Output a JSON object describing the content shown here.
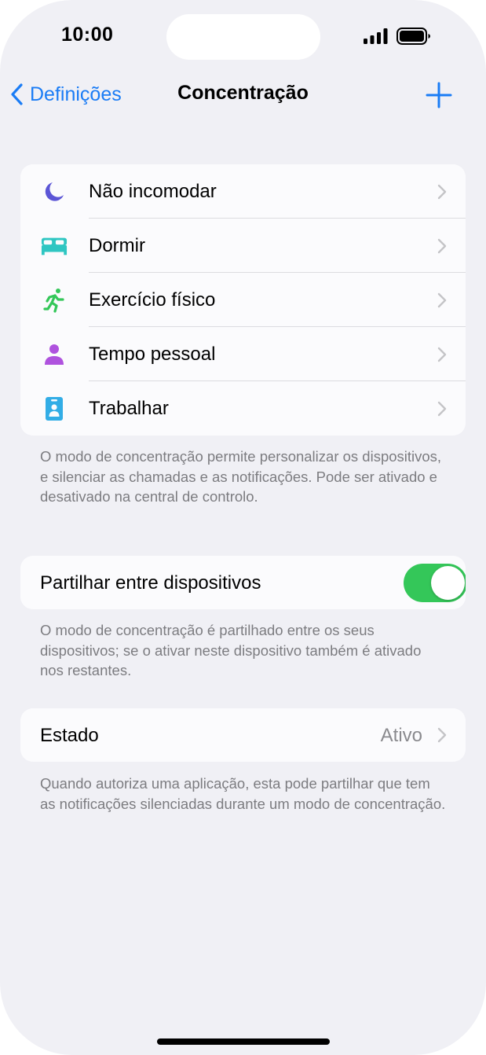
{
  "status_bar": {
    "time": "10:00"
  },
  "nav": {
    "back_label": "Definições",
    "title": "Concentração"
  },
  "focus_modes": [
    {
      "label": "Não incomodar",
      "icon": "moon-icon",
      "color": "#5b55d6"
    },
    {
      "label": "Dormir",
      "icon": "bed-icon",
      "color": "#2fc6c2"
    },
    {
      "label": "Exercício físico",
      "icon": "running-icon",
      "color": "#34c759"
    },
    {
      "label": "Tempo pessoal",
      "icon": "person-icon",
      "color": "#af52de"
    },
    {
      "label": "Trabalhar",
      "icon": "id-badge-icon",
      "color": "#32ade6"
    }
  ],
  "notes": {
    "focus_info": "O modo de concentração permite personalizar os dispositivos, e silenciar as chamadas e as notificações. Pode ser ativado e desativado na central de controlo.",
    "share_info": "O modo de concentração é partilhado entre os seus dispositivos; se o ativar neste dispositivo também é ativado nos restantes.",
    "state_info": "Quando autoriza uma aplicação, esta pode partilhar que tem as notificações silenciadas durante um modo de concentração."
  },
  "share": {
    "label": "Partilhar entre dispositivos",
    "enabled": true
  },
  "state": {
    "label": "Estado",
    "value": "Ativo"
  },
  "colors": {
    "accent": "#1a7cf5",
    "toggle_on": "#34c759",
    "background": "#f0f0f5"
  }
}
